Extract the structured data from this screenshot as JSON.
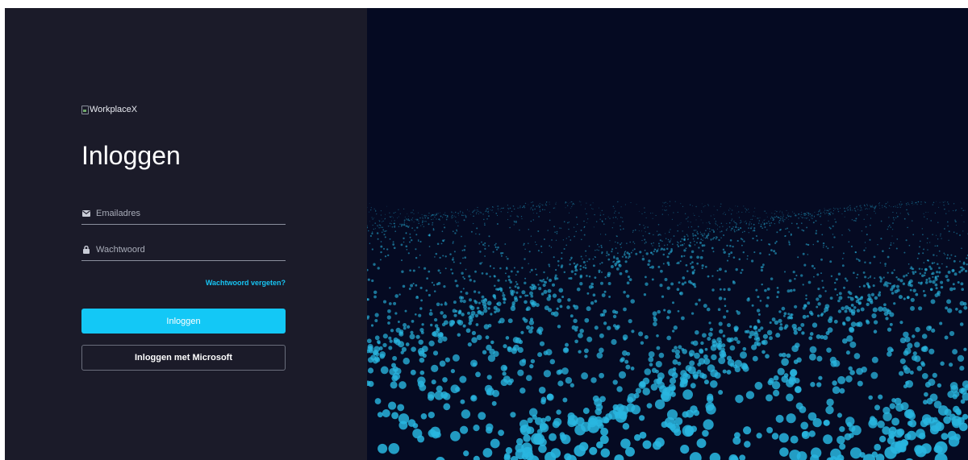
{
  "brand": {
    "logo_alt": "WorkplaceX"
  },
  "login": {
    "title": "Inloggen",
    "email_placeholder": "Emailadres",
    "email_icon": "envelope-icon",
    "password_placeholder": "Wachtwoord",
    "password_icon": "lock-icon",
    "forgot_password": "Wachtwoord vergeten?",
    "submit_label": "Inloggen",
    "microsoft_label": "Inloggen met Microsoft"
  },
  "colors": {
    "panel_bg": "#1b1b29",
    "accent": "#13c8f6",
    "hero_bg": "#050a22",
    "particle": "#29b6e0"
  }
}
